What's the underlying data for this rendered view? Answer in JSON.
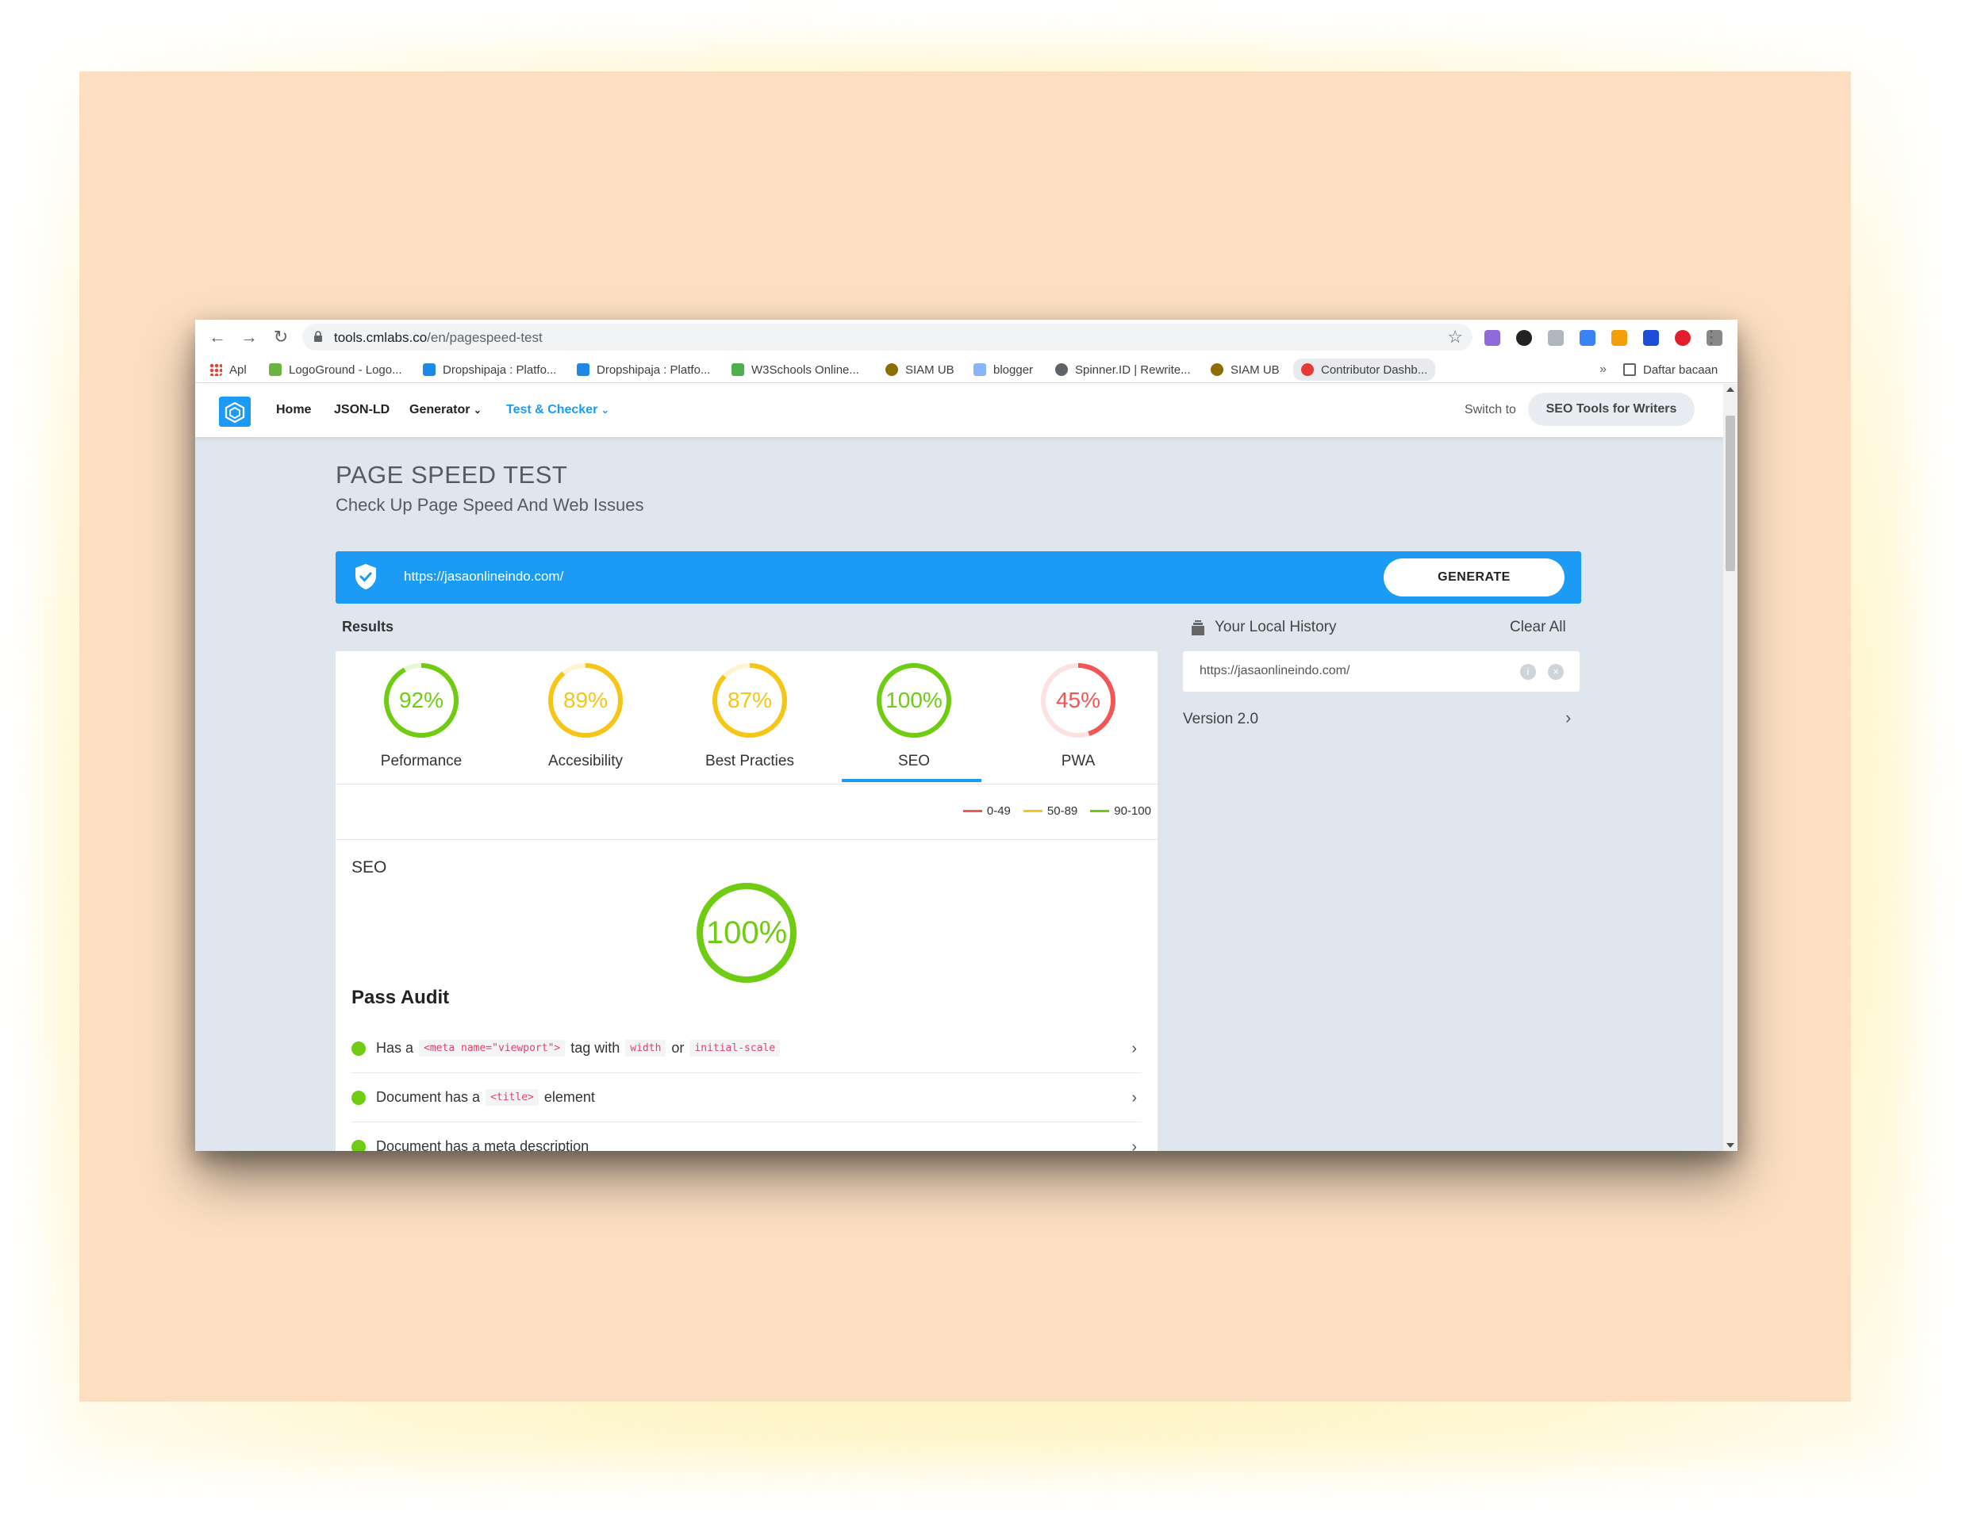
{
  "browser": {
    "url_host": "tools.cmlabs.co",
    "url_path": "/en/pagespeed-test",
    "bookmarks": [
      {
        "label": "Apl",
        "color": "#4285f4"
      },
      {
        "label": "LogoGround - Logo...",
        "color": "#6db33f"
      },
      {
        "label": "Dropshipaja : Platfo...",
        "color": "#1e88e5"
      },
      {
        "label": "Dropshipaja : Platfo...",
        "color": "#1e88e5"
      },
      {
        "label": "W3Schools Online...",
        "color": "#4caf50"
      },
      {
        "label": "SIAM UB",
        "color": "#8d6e00"
      },
      {
        "label": "blogger",
        "color": "#5f6368"
      },
      {
        "label": "Spinner.ID | Rewrite...",
        "color": "#5f6368"
      },
      {
        "label": "SIAM UB",
        "color": "#8d6e00"
      },
      {
        "label": "Contributor Dashb...",
        "color": "#e53935"
      }
    ],
    "bookmarks_more": "»",
    "reading_list": "Daftar bacaan"
  },
  "site": {
    "nav": {
      "home": "Home",
      "jsonld": "JSON-LD",
      "generator": "Generator",
      "test_checker": "Test & Checker",
      "switch_label": "Switch to",
      "switch_button": "SEO Tools for Writers"
    },
    "title": "PAGE SPEED TEST",
    "subtitle": "Check Up Page Speed And Web Issues",
    "input_url": "https://jasaonlineindo.com/",
    "generate": "GENERATE",
    "results_title": "Results"
  },
  "scores": [
    {
      "label": "Peformance",
      "value": 92,
      "pct": "92%",
      "color": "#6fcc12",
      "track": "#e8f7d4"
    },
    {
      "label": "Accesibility",
      "value": 89,
      "pct": "89%",
      "color": "#f5c518",
      "track": "#fdf4d2"
    },
    {
      "label": "Best Practies",
      "value": 87,
      "pct": "87%",
      "color": "#f5c518",
      "track": "#fdf4d2"
    },
    {
      "label": "SEO",
      "value": 100,
      "pct": "100%",
      "color": "#6fcc12",
      "track": "#e8f7d4"
    },
    {
      "label": "PWA",
      "value": 45,
      "pct": "45%",
      "color": "#f25656",
      "track": "#fde0e0"
    }
  ],
  "legend": [
    {
      "label": "0-49",
      "color": "#f25656"
    },
    {
      "label": "50-89",
      "color": "#f5c518"
    },
    {
      "label": "90-100",
      "color": "#6fcc12"
    }
  ],
  "detail": {
    "section": "SEO",
    "score": 100,
    "pct": "100%",
    "pass_title": "Pass Audit",
    "audits": [
      {
        "parts": [
          "Has a ",
          "<meta name=\"viewport\">",
          " tag with ",
          "width",
          " or ",
          "initial-scale",
          ""
        ]
      },
      {
        "parts": [
          "Document has a ",
          "<title>",
          " element"
        ]
      },
      {
        "parts": [
          "Document has a meta description"
        ]
      }
    ]
  },
  "history": {
    "title": "Your Local History",
    "clear": "Clear All",
    "items": [
      "https://jasaonlineindo.com/"
    ],
    "version": "Version 2.0"
  }
}
